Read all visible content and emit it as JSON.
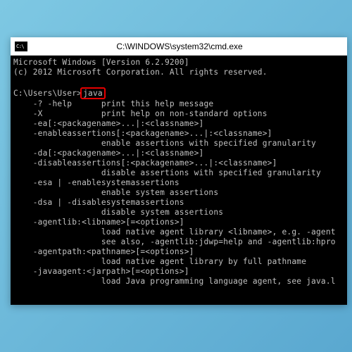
{
  "window": {
    "title": "C:\\WINDOWS\\system32\\cmd.exe"
  },
  "console": {
    "banner1": "Microsoft Windows [Version 6.2.9200]",
    "banner2": "(c) 2012 Microsoft Corporation. All rights reserved.",
    "prompt": "C:\\Users\\User>",
    "command": "java",
    "out01": "    -? -help      print this help message",
    "out02": "    -X            print help on non-standard options",
    "out03": "    -ea[:<packagename>...|:<classname>]",
    "out04": "    -enableassertions[:<packagename>...|:<classname>]",
    "out05": "                  enable assertions with specified granularity",
    "out06": "    -da[:<packagename>...|:<classname>]",
    "out07": "    -disableassertions[:<packagename>...|:<classname>]",
    "out08": "                  disable assertions with specified granularity",
    "out09": "    -esa | -enablesystemassertions",
    "out10": "                  enable system assertions",
    "out11": "    -dsa | -disablesystemassertions",
    "out12": "                  disable system assertions",
    "out13": "    -agentlib:<libname>[=<options>]",
    "out14": "                  load native agent library <libname>, e.g. -agent",
    "out15": "                  see also, -agentlib:jdwp=help and -agentlib:hpro",
    "out16": "    -agentpath:<pathname>[=<options>]",
    "out17": "                  load native agent library by full pathname",
    "out18": "    -javaagent:<jarpath>[=<options>]",
    "out19": "                  load Java programming language agent, see java.l"
  }
}
